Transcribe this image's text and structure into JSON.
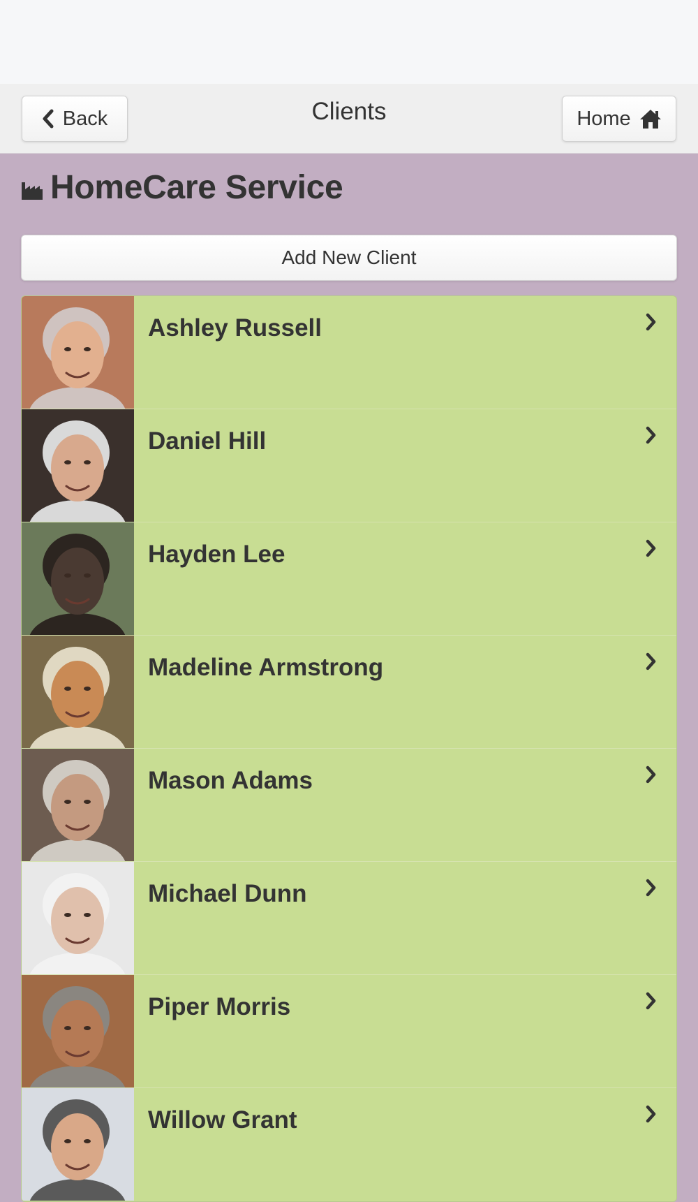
{
  "header": {
    "title": "Clients",
    "back_label": "Back",
    "home_label": "Home"
  },
  "company": {
    "name": "HomeCare Service",
    "icon": "industry-icon"
  },
  "add_button_label": "Add New Client",
  "clients": [
    {
      "name": "Ashley Russell",
      "avatar": "photo-elderly-woman",
      "bg": "#b87a5c",
      "skin": "#e2b08f",
      "hair": "#cfc3c0"
    },
    {
      "name": "Daniel Hill",
      "avatar": "photo-elderly-man",
      "bg": "#3a302c",
      "skin": "#d8a98d",
      "hair": "#d9d9d9"
    },
    {
      "name": "Hayden Lee",
      "avatar": "photo-elderly-man",
      "bg": "#6b7a5a",
      "skin": "#4a3a32",
      "hair": "#2c2520"
    },
    {
      "name": "Madeline Armstrong",
      "avatar": "photo-elderly-woman",
      "bg": "#7a6a4a",
      "skin": "#c98a55",
      "hair": "#e0d8c2"
    },
    {
      "name": "Mason Adams",
      "avatar": "photo-elderly-man",
      "bg": "#6d5c50",
      "skin": "#c49a80",
      "hair": "#cfcac2"
    },
    {
      "name": "Michael Dunn",
      "avatar": "photo-elderly-man",
      "bg": "#e8e8e8",
      "skin": "#e0c0ac",
      "hair": "#f2f2f2"
    },
    {
      "name": "Piper Morris",
      "avatar": "photo-elderly-woman",
      "bg": "#a06a45",
      "skin": "#b57a55",
      "hair": "#8a8680"
    },
    {
      "name": "Willow Grant",
      "avatar": "photo-elderly-woman",
      "bg": "#d8dce2",
      "skin": "#d9a888",
      "hair": "#5a5a5a"
    }
  ],
  "colors": {
    "page_bg": "#c2aec2",
    "list_item_bg": "#c8dd93",
    "header_bg": "#efefef",
    "status_bar_bg": "#f6f7f9"
  }
}
